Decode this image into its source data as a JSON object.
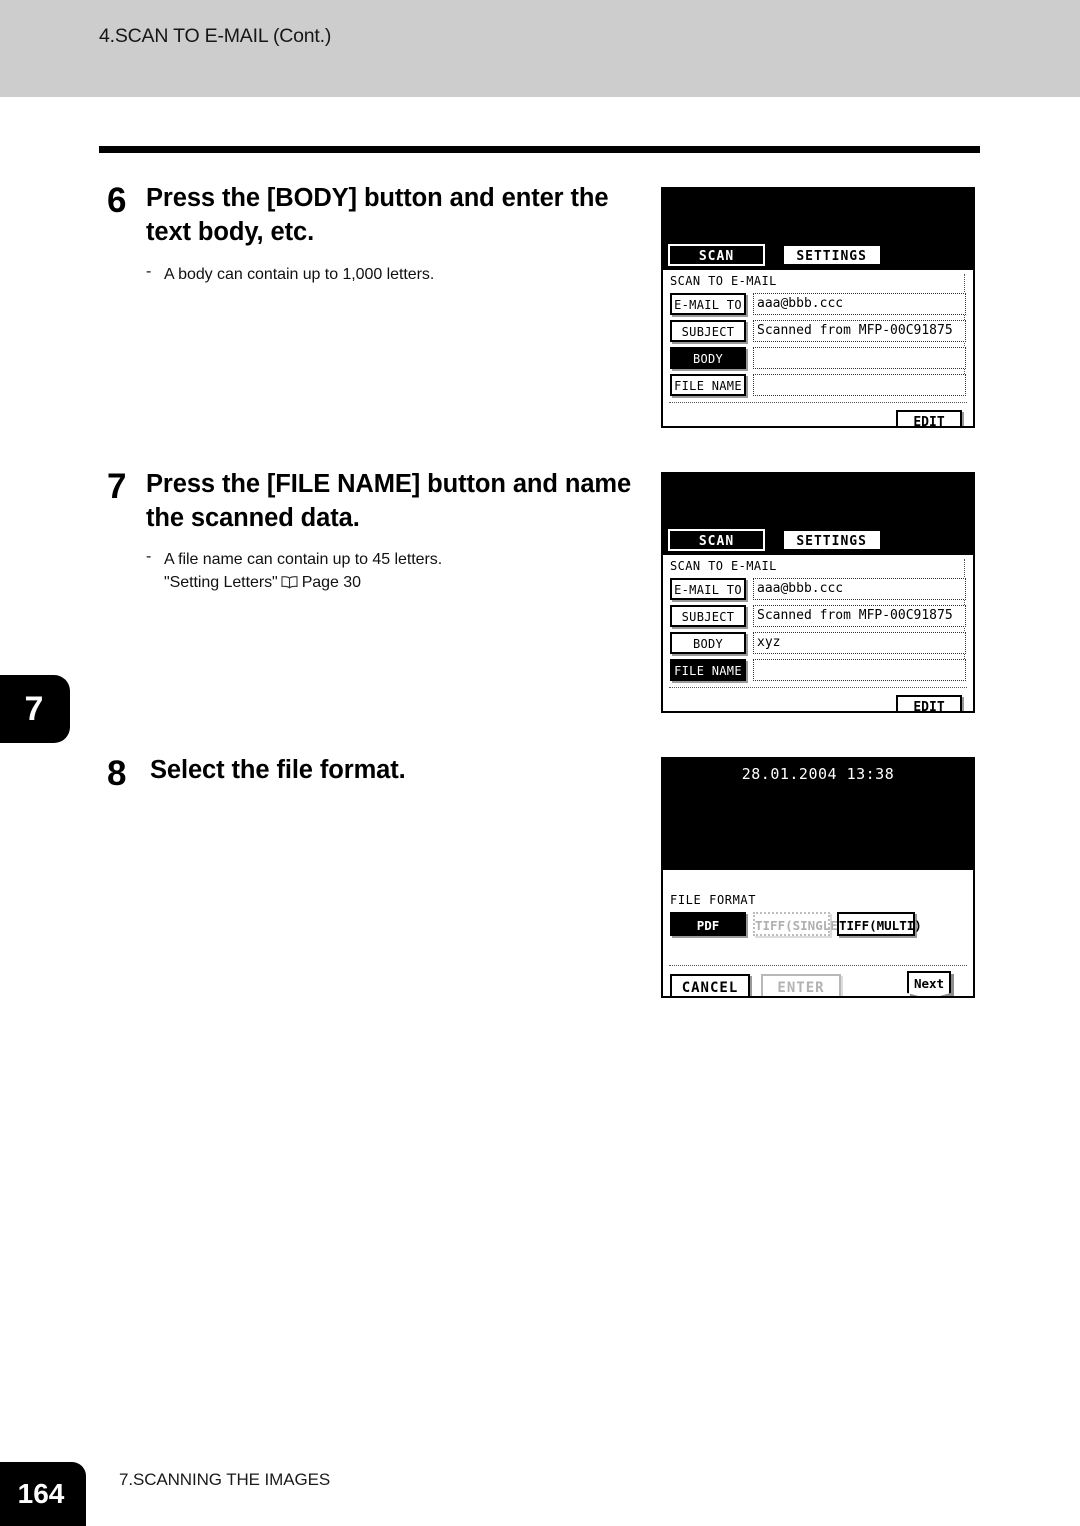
{
  "header": {
    "section_title": "4.SCAN TO E-MAIL (Cont.)"
  },
  "chapter_tab": {
    "number": "7"
  },
  "steps": [
    {
      "number": "6",
      "title": "Press the [BODY] button and enter the text body, etc.",
      "dash": "-",
      "note": "A body can contain up to 1,000 letters.",
      "note2": ""
    },
    {
      "number": "7",
      "title": "Press the [FILE NAME] button and name the scanned data.",
      "dash": "-",
      "note": "A file name can contain up to 45 letters.",
      "note2_prefix": "\"Setting Letters\"",
      "note2_icon": "book-icon",
      "note2_suffix": "Page 30"
    },
    {
      "number": "8",
      "title": "Select the file format.",
      "dash": "",
      "note": "",
      "note2": ""
    }
  ],
  "lcd_screens": [
    {
      "id": "scan-to-email-body",
      "tabs": [
        {
          "label": "SCAN",
          "selected": true
        },
        {
          "label": "SETTINGS",
          "selected": false
        }
      ],
      "caption": "SCAN TO E-MAIL",
      "fields": [
        {
          "button": "E-MAIL TO",
          "selected": false,
          "value": "aaa@bbb.ccc"
        },
        {
          "button": "SUBJECT",
          "selected": false,
          "value": "Scanned from MFP-00C91875"
        },
        {
          "button": "BODY",
          "selected": true,
          "value": ""
        },
        {
          "button": "FILE NAME",
          "selected": false,
          "value": ""
        }
      ],
      "edit_label": "EDIT"
    },
    {
      "id": "scan-to-email-filename",
      "tabs": [
        {
          "label": "SCAN",
          "selected": true
        },
        {
          "label": "SETTINGS",
          "selected": false
        }
      ],
      "caption": "SCAN TO E-MAIL",
      "fields": [
        {
          "button": "E-MAIL TO",
          "selected": false,
          "value": "aaa@bbb.ccc"
        },
        {
          "button": "SUBJECT",
          "selected": false,
          "value": "Scanned from MFP-00C91875"
        },
        {
          "button": "BODY",
          "selected": false,
          "value": "xyz"
        },
        {
          "button": "FILE NAME",
          "selected": true,
          "value": ""
        }
      ],
      "edit_label": "EDIT"
    },
    {
      "id": "file-format",
      "clock": "28.01.2004 13:38",
      "caption": "FILE FORMAT",
      "format_buttons": [
        {
          "label": "PDF",
          "state": "selected"
        },
        {
          "label": "TIFF(SINGLE)",
          "state": "disabled"
        },
        {
          "label": "TIFF(MULTI)",
          "state": "normal"
        }
      ],
      "bottom_buttons": [
        {
          "label": "CANCEL",
          "state": "normal"
        },
        {
          "label": "ENTER",
          "state": "disabled"
        }
      ],
      "next_label": "Next"
    }
  ],
  "footer": {
    "page_number": "164",
    "chapter_text": "7.SCANNING THE IMAGES"
  },
  "colors": {
    "header_band": "#cdcdcd",
    "ink": "#000000",
    "paper": "#ffffff",
    "disabled": "#b3b3b3"
  }
}
